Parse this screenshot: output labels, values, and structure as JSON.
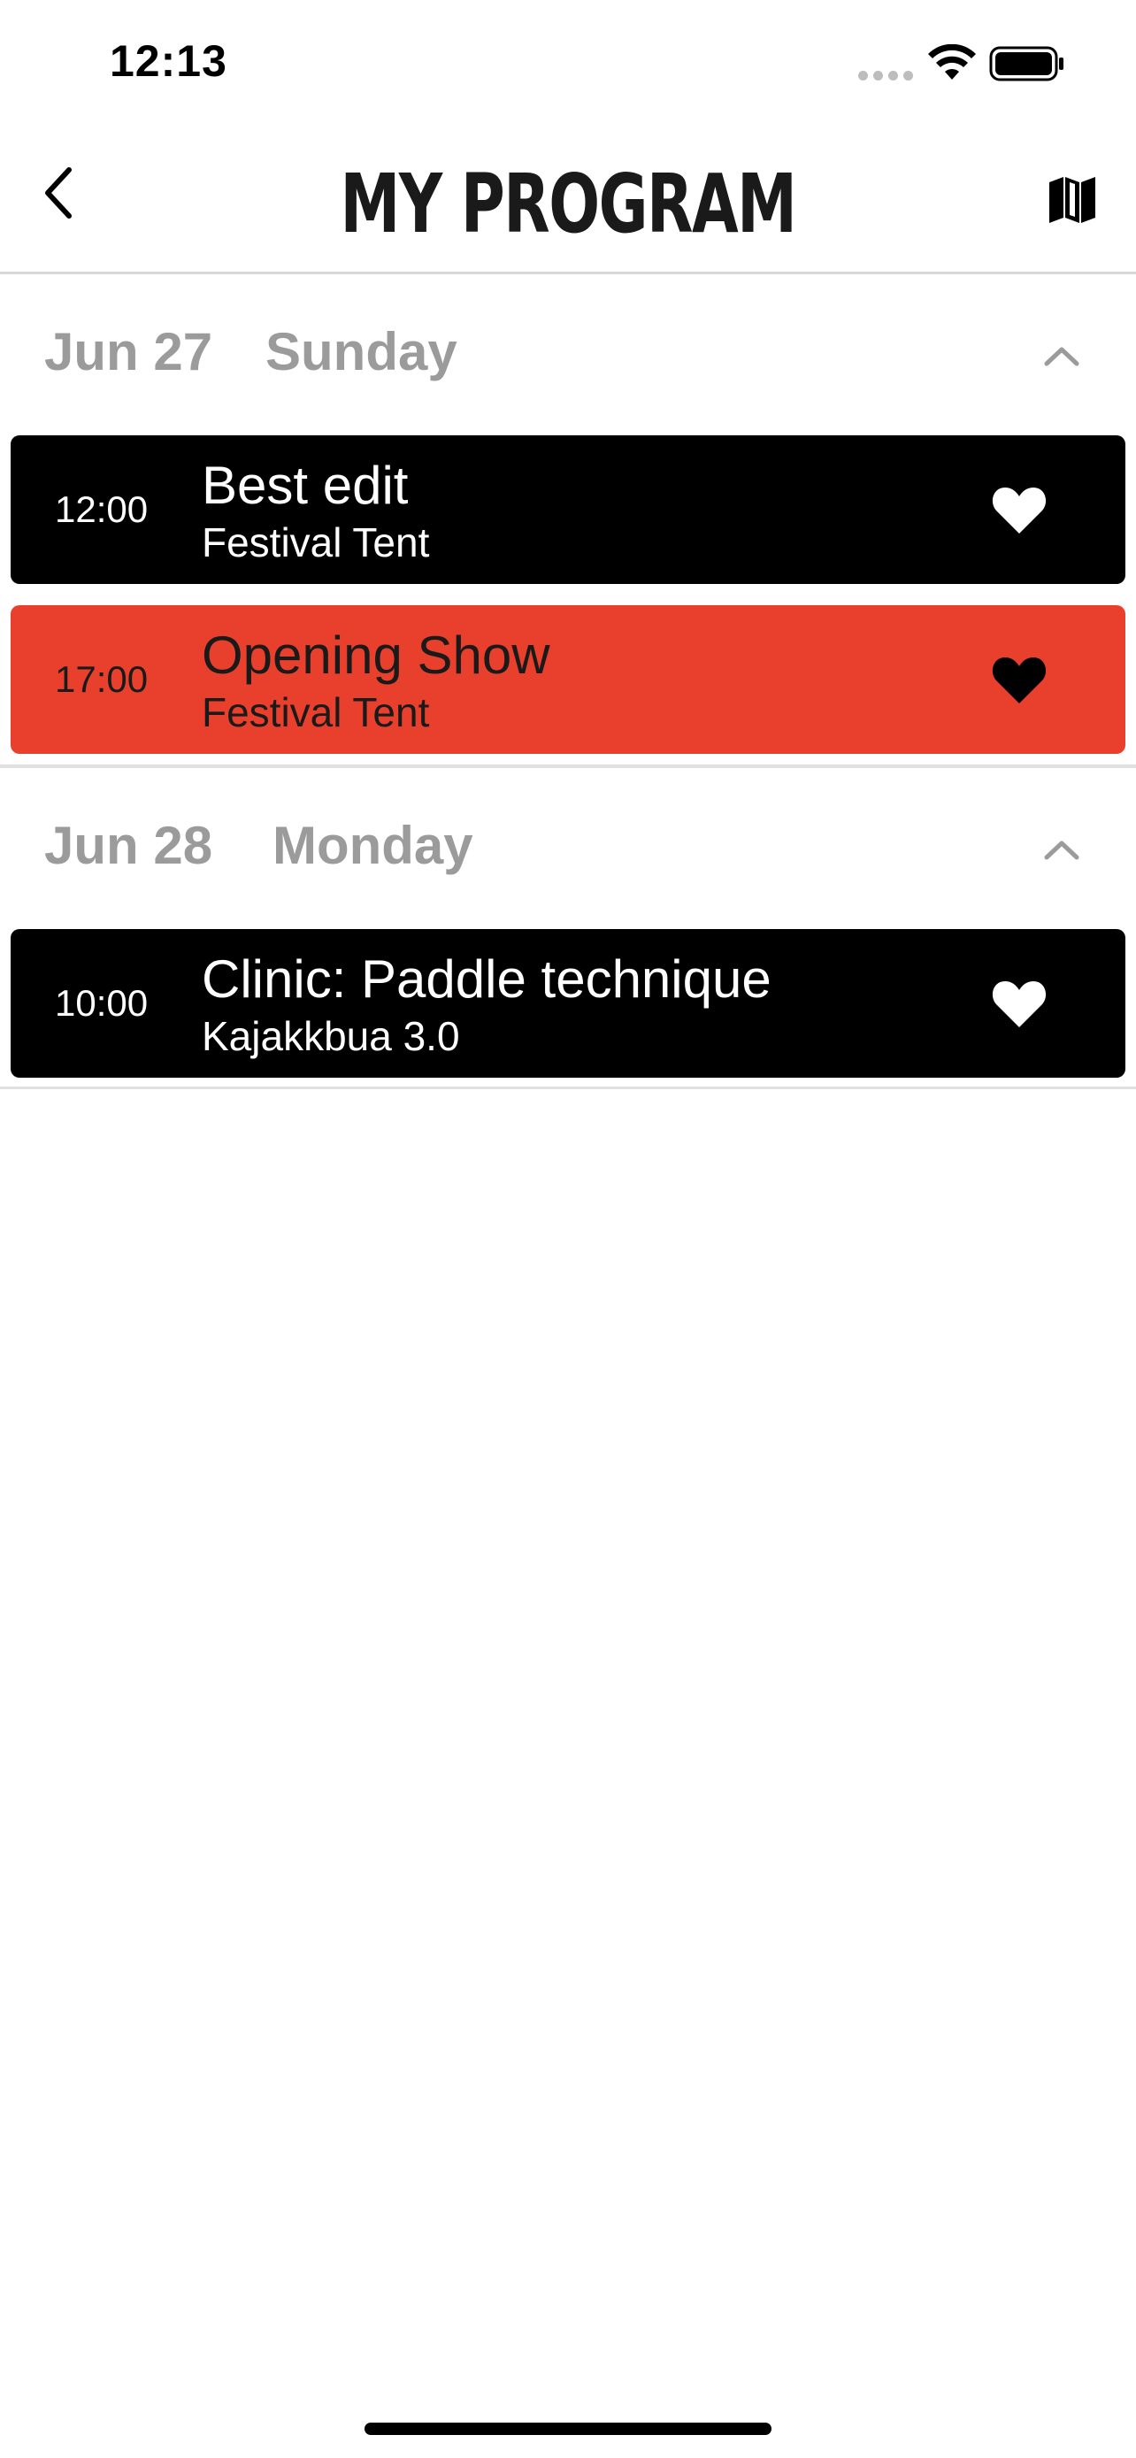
{
  "status_bar": {
    "time": "12:13"
  },
  "header": {
    "title": "MY PROGRAM",
    "back_icon": "chevron-left-icon",
    "map_icon": "map-icon"
  },
  "days": [
    {
      "date": "Jun 27",
      "weekday": "Sunday",
      "expanded": true,
      "events": [
        {
          "time": "12:00",
          "title": "Best edit",
          "venue": "Festival Tent",
          "style": "dark",
          "favorited": true
        },
        {
          "time": "17:00",
          "title": "Opening Show",
          "venue": "Festival Tent",
          "style": "red",
          "favorited": true
        }
      ]
    },
    {
      "date": "Jun 28",
      "weekday": "Monday",
      "expanded": true,
      "events": [
        {
          "time": "10:00",
          "title": "Clinic: Paddle technique",
          "venue": "Kajakkbua 3.0",
          "style": "dark",
          "favorited": true
        }
      ]
    }
  ],
  "colors": {
    "accent_red": "#e8402c",
    "dark_card": "#000000",
    "day_header_text": "#9b9b9b"
  }
}
